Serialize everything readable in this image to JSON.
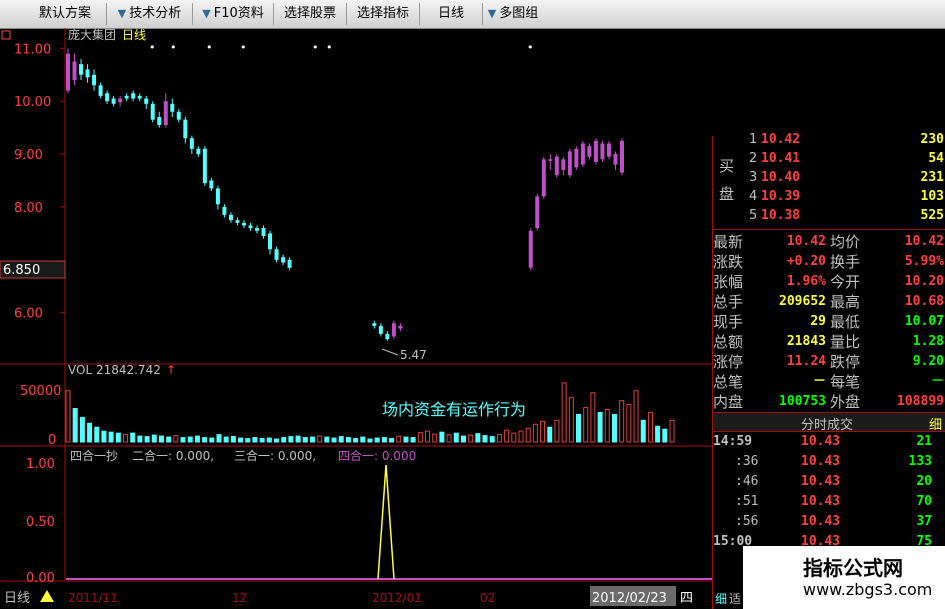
{
  "toolbar": {
    "items": [
      {
        "label": "默认方案",
        "arrow": false
      },
      {
        "label": "技术分析",
        "arrow": true
      },
      {
        "label": "F10资料",
        "arrow": true
      },
      {
        "label": "选择股票",
        "arrow": false
      },
      {
        "label": "选择指标",
        "arrow": false
      },
      {
        "label": "日线",
        "arrow": false
      },
      {
        "label": "多图组",
        "arrow": true
      }
    ]
  },
  "stock": {
    "name": "庞大集团",
    "period": "日线"
  },
  "price_axis": {
    "ticks": [
      "11.00",
      "10.00",
      "9.00",
      "8.00",
      "6.00"
    ],
    "current_label": "6.850",
    "low_annotation": "5.47"
  },
  "volume": {
    "label": "VOL 21842.742",
    "arrow": "↑",
    "ticks": [
      "50000",
      "0"
    ]
  },
  "annotation": "场内资金有运作行为",
  "indicator": {
    "label_parts": [
      "四合一抄",
      "二合一: 0.000,",
      "三合一: 0.000,",
      "四合一: 0.000"
    ],
    "ticks": [
      "1.00",
      "0.50",
      "0.00"
    ]
  },
  "date_axis": {
    "period_label": "日线",
    "labels": [
      "2011/11",
      "12",
      "2012/01",
      "02"
    ],
    "current_date": "2012/02/23",
    "weekday": "四"
  },
  "quote": {
    "buy_side_label": [
      "买",
      "盘"
    ],
    "bids": [
      {
        "level": "1",
        "price": "10.42",
        "vol": "230"
      },
      {
        "level": "2",
        "price": "10.41",
        "vol": "54"
      },
      {
        "level": "3",
        "price": "10.40",
        "vol": "231"
      },
      {
        "level": "4",
        "price": "10.39",
        "vol": "103"
      },
      {
        "level": "5",
        "price": "10.38",
        "vol": "525"
      }
    ],
    "stats": [
      {
        "l1": "最新",
        "v1": "10.42",
        "l2": "均价",
        "v2": "10.42"
      },
      {
        "l1": "涨跌",
        "v1": "+0.20",
        "l2": "换手",
        "v2": "5.99%"
      },
      {
        "l1": "张幅",
        "v1": "1.96%",
        "l2": "今开",
        "v2": "10.20"
      },
      {
        "l1": "总手",
        "v1": "209652",
        "l2": "最高",
        "v2": "10.68"
      },
      {
        "l1": "现手",
        "v1": "29",
        "l2": "最低",
        "v2": "10.07"
      },
      {
        "l1": "总额",
        "v1": "21843",
        "l2": "量比",
        "v2": "1.28"
      },
      {
        "l1": "涨停",
        "v1": "11.24",
        "l2": "跌停",
        "v2": "9.20"
      },
      {
        "l1": "总笔",
        "v1": "－",
        "l2": "每笔",
        "v2": "－"
      },
      {
        "l1": "内盘",
        "v1": "100753",
        "l2": "外盘",
        "v2": "108899"
      }
    ],
    "ticks_header": "分时成交",
    "ticks_tab": "细",
    "trades": [
      {
        "time": "14:59",
        "price": "10.43",
        "vol": "21"
      },
      {
        "time": ":36",
        "price": "10.43",
        "vol": "133"
      },
      {
        "time": ":46",
        "price": "10.43",
        "vol": "20"
      },
      {
        "time": ":51",
        "price": "10.43",
        "vol": "70"
      },
      {
        "time": ":56",
        "price": "10.43",
        "vol": "37"
      },
      {
        "time": "15:00",
        "price": "10.43",
        "vol": "75"
      }
    ],
    "bottom_tabs": [
      "细",
      "适"
    ]
  },
  "watermark": {
    "title": "指标公式网",
    "url": "www.zbgs3.com"
  },
  "colors": {
    "up": "#ff4040",
    "down": "#54ffff",
    "bull_candle": "#c050c8",
    "axis": "#a01010",
    "text_axis": "#ff4040",
    "yellow": "#ffff40",
    "gray": "#c0c0c0"
  },
  "chart_data": {
    "type": "candlestick",
    "ylim": [
      5.2,
      11.1
    ],
    "candles": [
      {
        "o": 10.2,
        "c": 10.9,
        "h": 11.0,
        "l": 10.15,
        "up": true
      },
      {
        "o": 10.4,
        "c": 10.75,
        "h": 10.9,
        "l": 10.3,
        "up": true
      },
      {
        "o": 10.7,
        "c": 10.5,
        "h": 10.8,
        "l": 10.4,
        "up": false
      },
      {
        "o": 10.6,
        "c": 10.45,
        "h": 10.7,
        "l": 10.35,
        "up": false
      },
      {
        "o": 10.5,
        "c": 10.3,
        "h": 10.6,
        "l": 10.2,
        "up": false
      },
      {
        "o": 10.3,
        "c": 10.1,
        "h": 10.35,
        "l": 10.05,
        "up": false
      },
      {
        "o": 10.15,
        "c": 10.0,
        "h": 10.2,
        "l": 9.95,
        "up": false
      },
      {
        "o": 10.05,
        "c": 9.95,
        "h": 10.1,
        "l": 9.9,
        "up": false
      },
      {
        "o": 9.98,
        "c": 10.05,
        "h": 10.1,
        "l": 9.9,
        "up": true
      },
      {
        "o": 10.05,
        "c": 10.1,
        "h": 10.15,
        "l": 10.0,
        "up": false
      },
      {
        "o": 10.05,
        "c": 10.15,
        "h": 10.2,
        "l": 10.0,
        "up": false
      },
      {
        "o": 10.1,
        "c": 10.05,
        "h": 10.15,
        "l": 10.0,
        "up": false
      },
      {
        "o": 10.05,
        "c": 9.95,
        "h": 10.1,
        "l": 9.85,
        "up": false
      },
      {
        "o": 9.95,
        "c": 9.65,
        "h": 10.0,
        "l": 9.6,
        "up": false
      },
      {
        "o": 9.7,
        "c": 9.55,
        "h": 9.8,
        "l": 9.5,
        "up": false
      },
      {
        "o": 9.55,
        "c": 10.0,
        "h": 10.15,
        "l": 9.5,
        "up": true
      },
      {
        "o": 9.95,
        "c": 9.8,
        "h": 10.05,
        "l": 9.7,
        "up": false
      },
      {
        "o": 9.8,
        "c": 9.65,
        "h": 9.85,
        "l": 9.6,
        "up": false
      },
      {
        "o": 9.65,
        "c": 9.3,
        "h": 9.7,
        "l": 9.2,
        "up": false
      },
      {
        "o": 9.3,
        "c": 9.1,
        "h": 9.35,
        "l": 9.0,
        "up": false
      },
      {
        "o": 9.1,
        "c": 9.0,
        "h": 9.15,
        "l": 8.95,
        "up": false
      },
      {
        "o": 9.1,
        "c": 8.45,
        "h": 9.15,
        "l": 8.4,
        "up": false
      },
      {
        "o": 8.5,
        "c": 8.35,
        "h": 8.55,
        "l": 8.3,
        "up": false
      },
      {
        "o": 8.35,
        "c": 8.05,
        "h": 8.4,
        "l": 7.95,
        "up": false
      },
      {
        "o": 8.0,
        "c": 7.85,
        "h": 8.05,
        "l": 7.8,
        "up": false
      },
      {
        "o": 7.85,
        "c": 7.75,
        "h": 7.9,
        "l": 7.7,
        "up": false
      },
      {
        "o": 7.75,
        "c": 7.7,
        "h": 7.8,
        "l": 7.65,
        "up": false
      },
      {
        "o": 7.7,
        "c": 7.65,
        "h": 7.75,
        "l": 7.6,
        "up": false
      },
      {
        "o": 7.65,
        "c": 7.6,
        "h": 7.7,
        "l": 7.55,
        "up": false
      },
      {
        "o": 7.6,
        "c": 7.55,
        "h": 7.65,
        "l": 7.5,
        "up": false
      },
      {
        "o": 7.6,
        "c": 7.45,
        "h": 7.65,
        "l": 7.4,
        "up": false
      },
      {
        "o": 7.5,
        "c": 7.2,
        "h": 7.55,
        "l": 7.1,
        "up": false
      },
      {
        "o": 7.2,
        "c": 7.0,
        "h": 7.25,
        "l": 6.95,
        "up": false
      },
      {
        "o": 7.05,
        "c": 6.95,
        "h": 7.1,
        "l": 6.9,
        "up": false
      },
      {
        "o": 7.0,
        "c": 6.85,
        "h": 7.05,
        "l": 6.8,
        "up": false
      },
      {
        "gap": true
      },
      {
        "gap": true
      },
      {
        "gap": true
      },
      {
        "gap": true
      },
      {
        "gap": true
      },
      {
        "gap": true
      },
      {
        "gap": true
      },
      {
        "gap": true
      },
      {
        "gap": true
      },
      {
        "gap": true
      },
      {
        "gap": true
      },
      {
        "gap": true
      },
      {
        "o": 5.8,
        "c": 5.75,
        "h": 5.85,
        "l": 5.7,
        "up": false
      },
      {
        "o": 5.75,
        "c": 5.6,
        "h": 5.8,
        "l": 5.55,
        "up": false
      },
      {
        "o": 5.6,
        "c": 5.5,
        "h": 5.65,
        "l": 5.47,
        "up": false
      },
      {
        "o": 5.55,
        "c": 5.8,
        "h": 5.85,
        "l": 5.5,
        "up": true
      },
      {
        "o": 5.7,
        "c": 5.75,
        "h": 5.8,
        "l": 5.65,
        "up": true
      },
      {
        "gap": true
      },
      {
        "gap": true
      },
      {
        "gap": true
      },
      {
        "gap": true
      },
      {
        "gap": true
      },
      {
        "gap": true
      },
      {
        "gap": true
      },
      {
        "gap": true
      },
      {
        "gap": true
      },
      {
        "gap": true
      },
      {
        "gap": true
      },
      {
        "gap": true
      },
      {
        "gap": true
      },
      {
        "gap": true
      },
      {
        "gap": true
      },
      {
        "gap": true
      },
      {
        "gap": true
      },
      {
        "gap": true
      },
      {
        "gap": true
      },
      {
        "o": 6.85,
        "c": 7.55,
        "h": 7.6,
        "l": 6.8,
        "up": true
      },
      {
        "o": 7.6,
        "c": 8.2,
        "h": 8.25,
        "l": 7.55,
        "up": true
      },
      {
        "o": 8.2,
        "c": 8.9,
        "h": 8.95,
        "l": 8.15,
        "up": true
      },
      {
        "o": 8.9,
        "c": 8.9,
        "h": 9.0,
        "l": 8.7,
        "up": true
      },
      {
        "o": 8.6,
        "c": 8.95,
        "h": 9.0,
        "l": 8.55,
        "up": true
      },
      {
        "o": 8.7,
        "c": 8.9,
        "h": 8.95,
        "l": 8.6,
        "up": true
      },
      {
        "o": 8.6,
        "c": 9.05,
        "h": 9.1,
        "l": 8.55,
        "up": true
      },
      {
        "o": 8.75,
        "c": 9.1,
        "h": 9.15,
        "l": 8.7,
        "up": true
      },
      {
        "o": 8.8,
        "c": 9.2,
        "h": 9.25,
        "l": 8.75,
        "up": true
      },
      {
        "o": 8.95,
        "c": 9.15,
        "h": 9.2,
        "l": 8.9,
        "up": true
      },
      {
        "o": 8.85,
        "c": 9.25,
        "h": 9.3,
        "l": 8.8,
        "up": true
      },
      {
        "o": 8.9,
        "c": 9.2,
        "h": 9.25,
        "l": 8.85,
        "up": true
      },
      {
        "o": 8.95,
        "c": 9.2,
        "h": 9.25,
        "l": 8.9,
        "up": true
      },
      {
        "o": 8.8,
        "c": 9.0,
        "h": 9.05,
        "l": 8.7,
        "up": true
      },
      {
        "o": 8.65,
        "c": 9.25,
        "h": 9.3,
        "l": 8.6,
        "up": true
      }
    ],
    "volume": [
      {
        "v": 52000,
        "up": true
      },
      {
        "v": 34000,
        "up": false
      },
      {
        "v": 25000,
        "up": false
      },
      {
        "v": 19000,
        "up": false
      },
      {
        "v": 15000,
        "up": false
      },
      {
        "v": 11000,
        "up": false
      },
      {
        "v": 10000,
        "up": false
      },
      {
        "v": 9000,
        "up": false
      },
      {
        "v": 7500,
        "up": true
      },
      {
        "v": 9000,
        "up": false
      },
      {
        "v": 6000,
        "up": false
      },
      {
        "v": 5500,
        "up": false
      },
      {
        "v": 7000,
        "up": false
      },
      {
        "v": 6000,
        "up": false
      },
      {
        "v": 5000,
        "up": false
      },
      {
        "v": 6500,
        "up": true
      },
      {
        "v": 4500,
        "up": false
      },
      {
        "v": 5000,
        "up": false
      },
      {
        "v": 6000,
        "up": false
      },
      {
        "v": 4500,
        "up": false
      },
      {
        "v": 4000,
        "up": false
      },
      {
        "v": 7500,
        "up": false
      },
      {
        "v": 5000,
        "up": false
      },
      {
        "v": 5500,
        "up": false
      },
      {
        "v": 4000,
        "up": false
      },
      {
        "v": 3500,
        "up": false
      },
      {
        "v": 4500,
        "up": false
      },
      {
        "v": 3500,
        "up": false
      },
      {
        "v": 4000,
        "up": false
      },
      {
        "v": 3000,
        "up": false
      },
      {
        "v": 4500,
        "up": false
      },
      {
        "v": 5500,
        "up": false
      },
      {
        "v": 6000,
        "up": false
      },
      {
        "v": 4500,
        "up": false
      },
      {
        "v": 5000,
        "up": false
      },
      {
        "v": 6000,
        "up": true
      },
      {
        "v": 5000,
        "up": false
      },
      {
        "v": 4000,
        "up": false
      },
      {
        "v": 5500,
        "up": false
      },
      {
        "v": 4500,
        "up": false
      },
      {
        "v": 3500,
        "up": false
      },
      {
        "v": 5000,
        "up": false
      },
      {
        "v": 3000,
        "up": false
      },
      {
        "v": 4000,
        "up": false
      },
      {
        "v": 4500,
        "up": false
      },
      {
        "v": 3500,
        "up": false
      },
      {
        "v": 6000,
        "up": true
      },
      {
        "v": 5000,
        "up": false
      },
      {
        "v": 4500,
        "up": false
      },
      {
        "v": 9500,
        "up": true
      },
      {
        "v": 11000,
        "up": true
      },
      {
        "v": 8000,
        "up": true
      },
      {
        "v": 10000,
        "up": false
      },
      {
        "v": 7500,
        "up": true
      },
      {
        "v": 9000,
        "up": false
      },
      {
        "v": 6000,
        "up": false
      },
      {
        "v": 7000,
        "up": true
      },
      {
        "v": 8500,
        "up": false
      },
      {
        "v": 6500,
        "up": false
      },
      {
        "v": 5500,
        "up": false
      },
      {
        "v": 7500,
        "up": true
      },
      {
        "v": 12000,
        "up": true
      },
      {
        "v": 9000,
        "up": true
      },
      {
        "v": 11000,
        "up": true
      },
      {
        "v": 14000,
        "up": true
      },
      {
        "v": 18000,
        "up": true
      },
      {
        "v": 21000,
        "up": true
      },
      {
        "v": 15000,
        "up": false
      },
      {
        "v": 22000,
        "up": true
      },
      {
        "v": 60000,
        "up": true
      },
      {
        "v": 45000,
        "up": true
      },
      {
        "v": 28000,
        "up": false
      },
      {
        "v": 35000,
        "up": true
      },
      {
        "v": 50000,
        "up": true
      },
      {
        "v": 30000,
        "up": false
      },
      {
        "v": 33000,
        "up": true
      },
      {
        "v": 28000,
        "up": false
      },
      {
        "v": 42000,
        "up": true
      },
      {
        "v": 38000,
        "up": true
      },
      {
        "v": 52000,
        "up": true
      },
      {
        "v": 22000,
        "up": false
      },
      {
        "v": 30000,
        "up": true
      },
      {
        "v": 16000,
        "up": false
      },
      {
        "v": 13000,
        "up": false
      },
      {
        "v": 22000,
        "up": true
      }
    ],
    "vol_max": 65000,
    "indicator_spike_index": 46
  }
}
